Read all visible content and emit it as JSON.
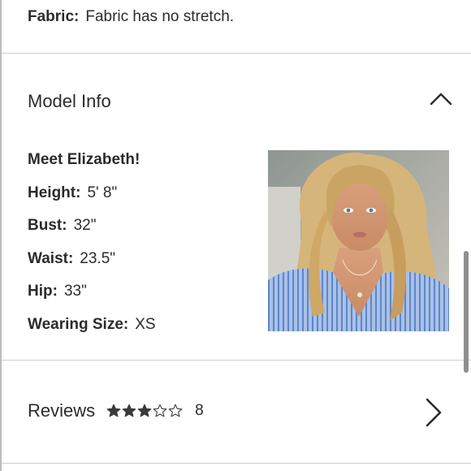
{
  "fabric": {
    "label": "Fabric:",
    "value": "Fabric has no stretch."
  },
  "model_info": {
    "title": "Model Info",
    "toggle_icon": "chevron-up-icon",
    "meet": "Meet Elizabeth!",
    "details": [
      {
        "label": "Height:",
        "value": "5' 8\""
      },
      {
        "label": "Bust:",
        "value": "32\""
      },
      {
        "label": "Waist:",
        "value": "23.5\""
      },
      {
        "label": "Hip:",
        "value": "33\""
      },
      {
        "label": "Wearing Size:",
        "value": "XS"
      }
    ],
    "photo_alt": "model-photo"
  },
  "reviews": {
    "title": "Reviews",
    "rating": 3,
    "max_rating": 5,
    "count": "8",
    "arrow_icon": "chevron-right-icon"
  },
  "colors": {
    "text": "#2b2b2b",
    "divider": "#cfcfcf",
    "star": "#3a3a3a"
  }
}
